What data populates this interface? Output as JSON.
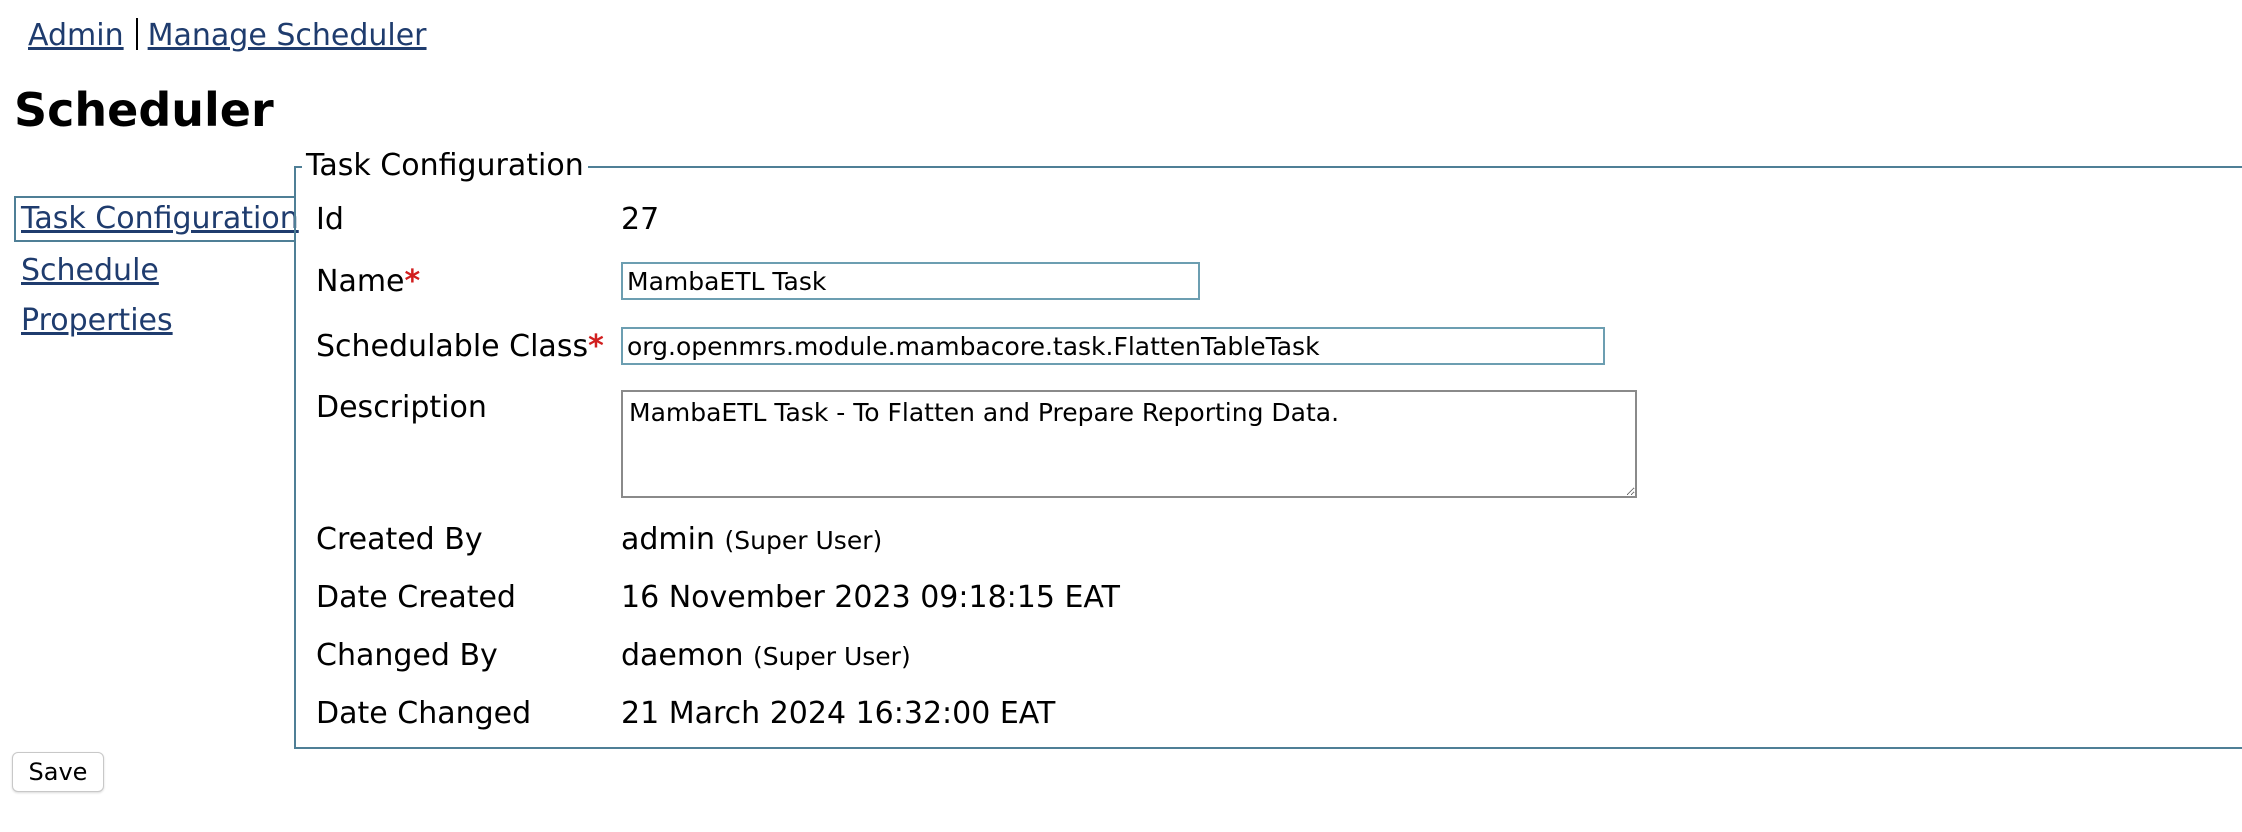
{
  "breadcrumb": {
    "items": [
      {
        "label": "Admin"
      },
      {
        "label": "Manage Scheduler"
      }
    ]
  },
  "page": {
    "title": "Scheduler"
  },
  "side_nav": {
    "items": [
      {
        "label": "Task Configuration",
        "active": true
      },
      {
        "label": "Schedule",
        "active": false
      },
      {
        "label": "Properties",
        "active": false
      }
    ]
  },
  "task_config": {
    "legend": "Task Configuration",
    "id": {
      "label": "Id",
      "value": "27"
    },
    "name": {
      "label": "Name",
      "required_mark": "*",
      "value": "MambaETL Task"
    },
    "schedulable_class": {
      "label": "Schedulable Class",
      "required_mark": "*",
      "value": "org.openmrs.module.mambacore.task.FlattenTableTask"
    },
    "description": {
      "label": "Description",
      "value": "MambaETL Task - To Flatten and Prepare Reporting Data."
    },
    "created_by": {
      "label": "Created By",
      "user": "admin",
      "role": "(Super User)"
    },
    "date_created": {
      "label": "Date Created",
      "value": "16 November 2023 09:18:15 EAT"
    },
    "changed_by": {
      "label": "Changed By",
      "user": "daemon",
      "role": "(Super User)"
    },
    "date_changed": {
      "label": "Date Changed",
      "value": "21 March 2024 16:32:00 EAT"
    }
  },
  "actions": {
    "save_label": "Save"
  },
  "colors": {
    "link": "#1f3c6e",
    "panel_border": "#4f7f96",
    "required": "#d11f1f"
  }
}
